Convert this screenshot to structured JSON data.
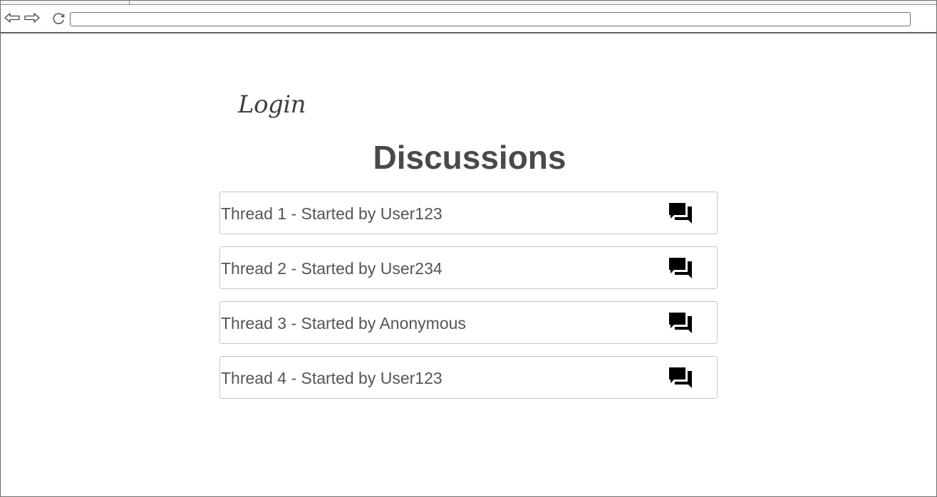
{
  "browser": {
    "address_value": "",
    "icons": {
      "back": "back-arrow-icon",
      "forward": "forward-arrow-icon",
      "reload": "reload-icon"
    }
  },
  "page": {
    "login_label": "Login",
    "title": "Discussions",
    "threads": [
      {
        "label": "Thread 1 - Started by User123",
        "icon": "chat-bubbles-icon"
      },
      {
        "label": "Thread 2 - Started by User234",
        "icon": "chat-bubbles-icon"
      },
      {
        "label": "Thread 3 - Started by Anonymous",
        "icon": "chat-bubbles-icon"
      },
      {
        "label": "Thread 4 - Started by User123",
        "icon": "chat-bubbles-icon"
      }
    ]
  },
  "colors": {
    "title_text": "#4a4a4a",
    "body_text": "#555555",
    "border": "#c4c4c4",
    "icon": "#000000"
  }
}
